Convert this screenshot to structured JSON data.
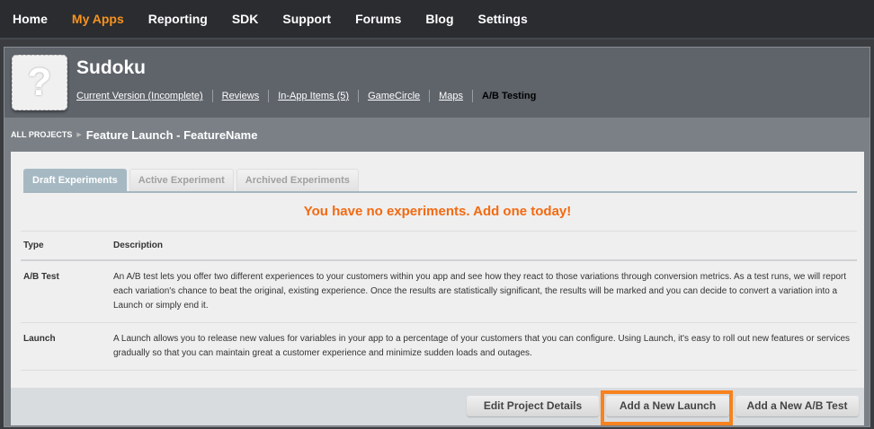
{
  "nav": {
    "items": [
      "Home",
      "My Apps",
      "Reporting",
      "SDK",
      "Support",
      "Forums",
      "Blog",
      "Settings"
    ],
    "active": "My Apps"
  },
  "app": {
    "icon": "?",
    "title": "Sudoku",
    "links": [
      "Current Version (Incomplete)",
      "Reviews",
      "In-App Items (5)",
      "GameCircle",
      "Maps"
    ],
    "current": "A/B Testing"
  },
  "breadcrumb": {
    "root": "ALL PROJECTS",
    "current": "Feature Launch - FeatureName"
  },
  "tabs": [
    "Draft Experiments",
    "Active Experiment",
    "Archived Experiments"
  ],
  "empty_message": "You have no experiments. Add one today!",
  "table": {
    "headers": [
      "Type",
      "Description"
    ],
    "rows": [
      {
        "type": "A/B Test",
        "description": "An A/B test lets you offer two different experiences to your customers within you app and see how they react to those variations through conversion metrics. As a test runs, we will report each variation's chance to beat the original, existing experience. Once the results are statistically significant, the results will be marked and you can decide to convert a variation into a Launch or simply end it."
      },
      {
        "type": "Launch",
        "description": "A Launch allows you to release new values for variables in your app to a percentage of your customers that you can configure. Using Launch, it's easy to roll out new features or services gradually so that you can maintain great a customer experience and minimize sudden loads and outages."
      }
    ]
  },
  "buttons": {
    "edit": "Edit Project Details",
    "launch": "Add a New Launch",
    "ab": "Add a New A/B Test"
  },
  "colors": {
    "accent": "#f7931e",
    "highlight": "#f7821e",
    "message": "#f26a12"
  }
}
